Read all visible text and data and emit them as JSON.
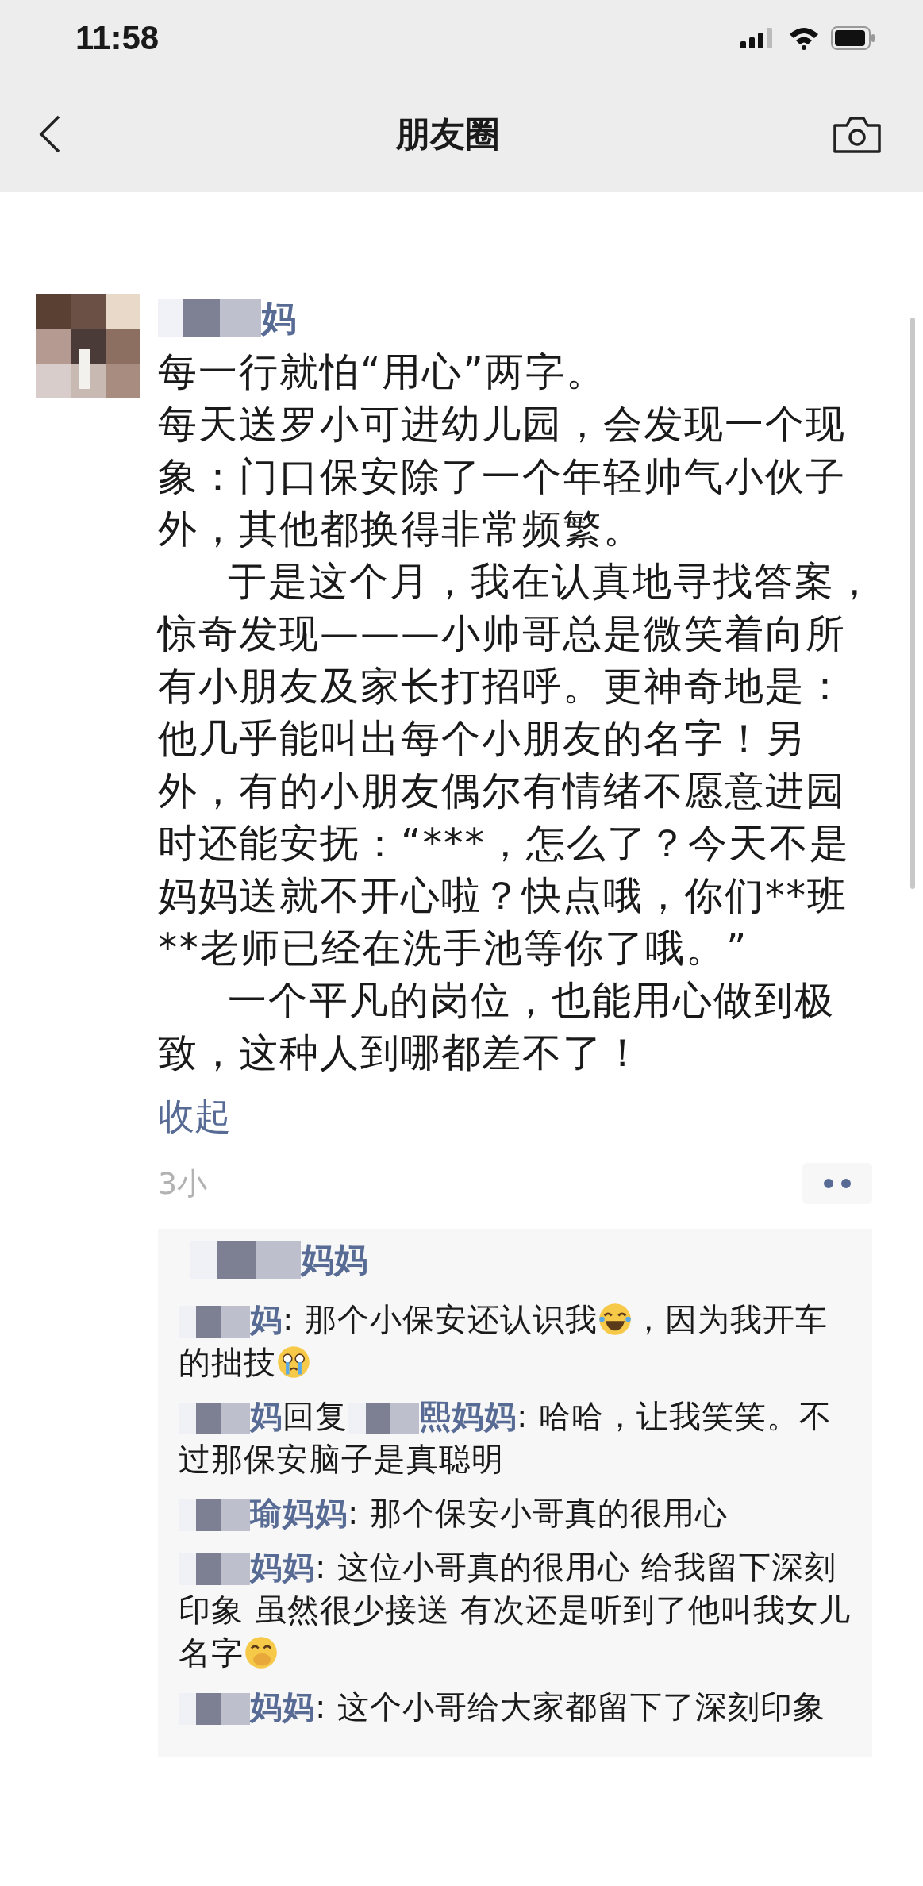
{
  "status_bar": {
    "time": "11:58"
  },
  "nav": {
    "title": "朋友圈"
  },
  "post": {
    "author": "妈",
    "paragraphs": [
      {
        "text": "每一行就怕“用心”两字。",
        "indented": false
      },
      {
        "text": "每天送罗小可进幼儿园，会发现一个现象：门口保安除了一个年轻帅气小伙子外，其他都换得非常频繁。",
        "indented": false
      },
      {
        "text": "于是这个月，我在认真地寻找答案，惊奇发现———小帅哥总是微笑着向所有小朋友及家长打招呼。更神奇地是：他几乎能叫出每个小朋友的名字！另外，有的小朋友偶尔有情绪不愿意进园时还能安抚：“***，怎么了？今天不是妈妈送就不开心啦？快点哦，你们**班**老师已经在洗手池等你了哦。”",
        "indented": true
      },
      {
        "text": "一个平凡的岗位，也能用心做到极致，这种人到哪都差不了！",
        "indented": true
      }
    ],
    "collapse_link": "收起",
    "time": "3小"
  },
  "likes": {
    "names": "妈妈"
  },
  "comments": [
    {
      "author": "妈",
      "segments": [
        {
          "kind": "text",
          "text": ": 那个小保安还认识我"
        },
        {
          "kind": "laugh"
        },
        {
          "kind": "text",
          "text": "，因为我开车的拙技"
        },
        {
          "kind": "cry"
        }
      ]
    },
    {
      "author": "妈",
      "reply_word": "回复",
      "reply_to": "熙妈妈",
      "segments": [
        {
          "kind": "text",
          "text": ": 哈哈，让我笑笑。不过那保安脑子是真聪明"
        }
      ]
    },
    {
      "author": "瑜妈妈",
      "segments": [
        {
          "kind": "text",
          "text": ": 那个保安小哥真的很用心"
        }
      ]
    },
    {
      "author": "妈妈",
      "segments": [
        {
          "kind": "text",
          "text": ": 这位小哥真的很用心 给我留下深刻印象 虽然很少接送 有次还是听到了他叫我女儿名字"
        },
        {
          "kind": "cover"
        }
      ]
    },
    {
      "author": "妈妈",
      "segments": [
        {
          "kind": "text",
          "text": ": 这个小哥给大家都留下了深刻印象"
        }
      ]
    }
  ]
}
